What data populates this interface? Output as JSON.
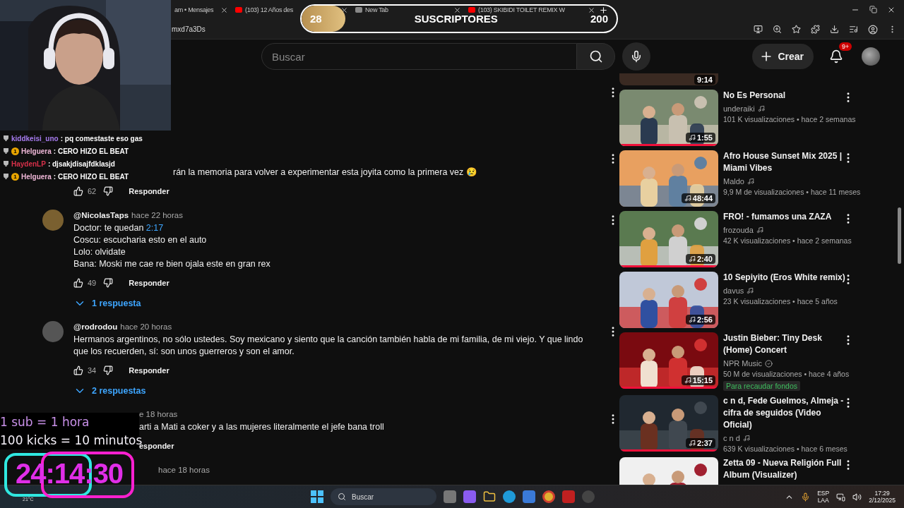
{
  "browser": {
    "tabs": [
      {
        "title": "am • Mensajes",
        "kind": "plain"
      },
      {
        "title": "(103) 12 Años des",
        "kind": "youtube"
      },
      {
        "title": "New Tab",
        "kind": "newtab"
      },
      {
        "title": "(103) SKIBIDI TOILET REMIX W",
        "kind": "youtube"
      }
    ],
    "address": "mxd7a3Ds"
  },
  "header": {
    "search": {
      "placeholder": "Buscar"
    },
    "create_label": "Crear",
    "notifications": "9+"
  },
  "comments": [
    {
      "kind": "covered"
    },
    {
      "kind": "chat-covered",
      "lines": [
        {
          "text": "rán la memoria para volver a experimentar esta joyita como la primera vez 😢"
        }
      ],
      "likes": "62",
      "reply": "Responder"
    },
    {
      "kind": "full",
      "author": "@NicolasTaps",
      "time": "hace 22 horas",
      "lines": [
        {
          "text": "Doctor: te quedan ",
          "timestamp": "2:17"
        },
        {
          "text": "Coscu: escucharia esto en el auto"
        },
        {
          "text": "Lolo: olvidate"
        },
        {
          "text": "Bana: Moski me cae re bien ojala este en gran rex"
        }
      ],
      "likes": "49",
      "reply": "Responder",
      "replies": "1 respuesta"
    },
    {
      "kind": "full",
      "author": "@rodrodou",
      "time": "hace 20 horas",
      "lines": [
        {
          "text": "Hermanos argentinos, no sólo ustedes. Soy mexicano y siento que la canción también habla de mi familia, de mi viejo. Y que lindo que los recuerden, sí: son unos guerreros y son el amor."
        }
      ],
      "likes": "34",
      "reply": "Responder",
      "replies": "2 respuestas"
    },
    {
      "kind": "goal-covered",
      "time": "e 18 horas",
      "lines": [
        {
          "text": "arti a Mati a coker y a las mujeres literalmente el jefe bana troll"
        }
      ],
      "reply": "esponder"
    },
    {
      "kind": "timer-covered",
      "time": "hace 18 horas"
    }
  ],
  "recommendations": {
    "top_duration": "9:14",
    "videos": [
      {
        "title": "No Es Personal",
        "channel": "underaiki",
        "kind": "artist",
        "meta": "101 K visualizaciones • hace 2 semanas",
        "duration": "1:55",
        "watched": true
      },
      {
        "title": "Afro House Sunset Mix 2025 | Miami Vibes",
        "channel": "Maldo",
        "kind": "artist",
        "meta": "9,9 M de visualizaciones • hace 11 meses",
        "duration": "48:44",
        "watched": false
      },
      {
        "title": "FRO! - fumamos una ZAZA",
        "channel": "frozouda",
        "kind": "artist",
        "meta": "42 K visualizaciones • hace 2 semanas",
        "duration": "2:40",
        "watched": true
      },
      {
        "title": "10 Sepiyito (Eros White remix)",
        "channel": "davus",
        "kind": "artist",
        "meta": "23 K visualizaciones • hace 5 años",
        "duration": "2:56",
        "watched": false
      },
      {
        "title": "Justin Bieber: Tiny Desk (Home) Concert",
        "channel": "NPR Music",
        "kind": "verified",
        "meta": "50 M de visualizaciones • hace 4 años",
        "duration": "15:15",
        "watched": true,
        "badge": "Para recaudar fondos"
      },
      {
        "title": "c n d, Fede Guelmos, Almeja - cifra de seguidos (Video Oficial)",
        "channel": "c n d",
        "kind": "artist",
        "meta": "639 K visualizaciones • hace 6 meses",
        "duration": "2:37",
        "watched": true
      },
      {
        "title": "Zetta 09 - Nueva Religión Full Album (Visualizer)",
        "watched": false
      }
    ]
  },
  "stream_overlay": {
    "chat": [
      {
        "user": "kiddkeisi_uno",
        "color": "#a77cf0",
        "message": ": pq comestaste eso gas"
      },
      {
        "user": "Helguera",
        "color": "#f0b8d8",
        "sub_badge": "1",
        "message": ": CERO HIZO EL BEAT"
      },
      {
        "user": "HaydenLP",
        "color": "#d8304a",
        "message": ": djsakjdisajfdklasjd"
      },
      {
        "user": "Helguera",
        "color": "#f0b8d8",
        "sub_badge": "1",
        "message": ": CERO HIZO EL BEAT"
      }
    ],
    "sub_goal": {
      "current": "28",
      "label": "SUSCRIPTORES",
      "target": "200",
      "level": 0.14
    },
    "rules": [
      "1 sub = 1 hora",
      "100 kicks = 10 minutos"
    ],
    "timer": "24:14:30",
    "weather": "21°C"
  },
  "taskbar": {
    "search": "Buscar",
    "lang": "ESP",
    "region": "LAA",
    "time": "17:29",
    "date": "2/12/2025"
  }
}
